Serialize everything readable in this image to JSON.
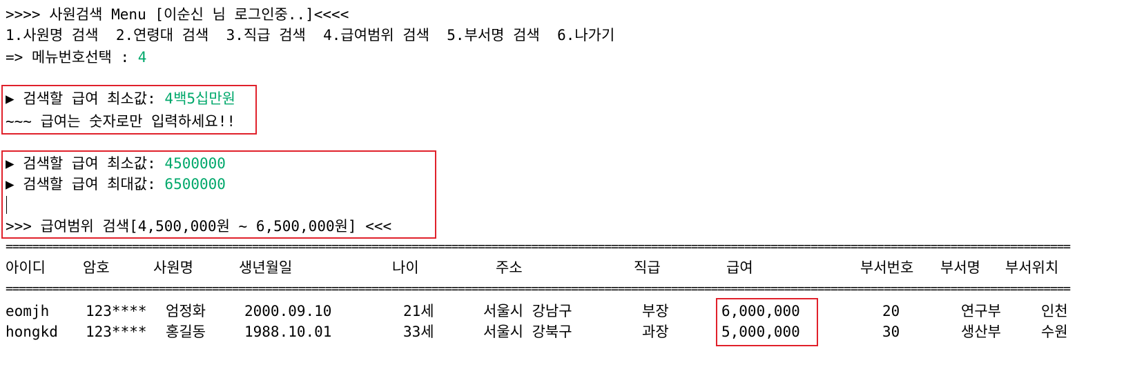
{
  "console": {
    "header": ">>>> 사원검색 Menu [이순신 님 로그인중..]<<<<",
    "menu": "1.사원명 검색  2.연령대 검색  3.직급 검색  4.급여범위 검색  5.부서명 검색  6.나가기",
    "prompt_label": "=> 메뉴번호선택 : ",
    "prompt_value": "4",
    "min_prompt_label": "▶ 검색할 급여 최소값: ",
    "min_invalid_value": "4백5십만원",
    "error_msg": "~~~ 급여는 숫자로만 입력하세요!!",
    "min_prompt_label2": "▶ 검색할 급여 최소값: ",
    "min_value": "4500000",
    "max_prompt_label": "▶ 검색할 급여 최대값: ",
    "max_value": "6500000",
    "result_title": ">>> 급여범위 검색[4,500,000원 ~ 6,500,000원] <<<",
    "separator": "================================================================================================================================================================"
  },
  "table": {
    "headers": [
      "아이디",
      "암호",
      "사원명",
      "생년월일",
      "나이",
      "주소",
      "직급",
      "급여",
      "부서번호",
      "부서명",
      "부서위치"
    ],
    "rows": [
      [
        "eomjh",
        "123****",
        "엄정화",
        "2000.09.10",
        "21세",
        "서울시 강남구",
        "부장",
        "6,000,000",
        "20",
        "연구부",
        "인천"
      ],
      [
        "hongkd",
        "123****",
        "홍길동",
        "1988.10.01",
        "33세",
        "서울시 강북구",
        "과장",
        "5,000,000",
        "30",
        "생산부",
        "수원"
      ]
    ]
  },
  "colors": {
    "input_green": "#00a86b",
    "highlight_red": "#e0202a"
  }
}
